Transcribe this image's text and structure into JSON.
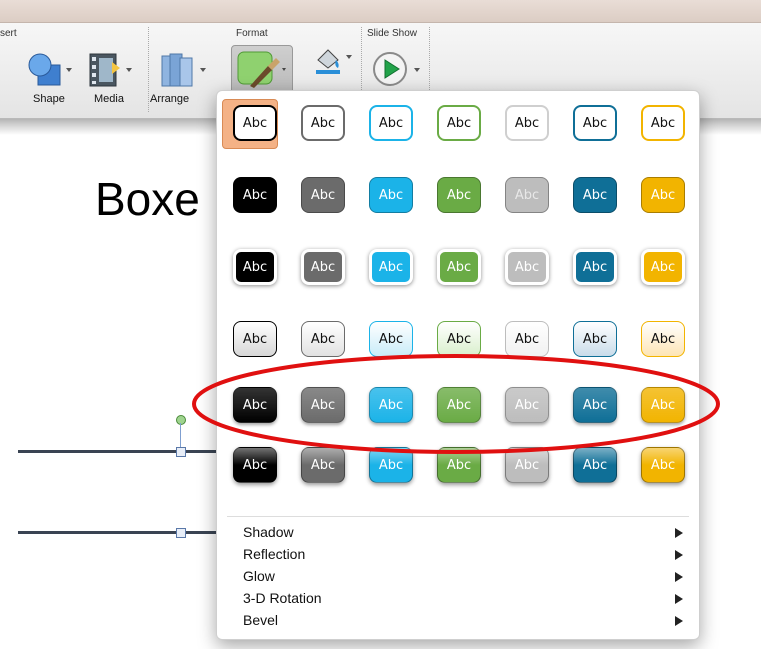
{
  "ribbon": {
    "groups": {
      "insert_partial": "sert",
      "format": "Format",
      "slide_show": "Slide Show"
    },
    "tools": {
      "shape": "Shape",
      "media": "Media",
      "arrange": "Arrange"
    }
  },
  "slide": {
    "title_partial": "Boxe"
  },
  "gallery": {
    "rows": [
      {
        "style": "outline",
        "cells": [
          "Abc",
          "Abc",
          "Abc",
          "Abc",
          "Abc",
          "Abc",
          "Abc"
        ]
      },
      {
        "style": "fill",
        "cells": [
          "Abc",
          "Abc",
          "Abc",
          "Abc",
          "Abc",
          "Abc",
          "Abc"
        ]
      },
      {
        "style": "fill-white-border",
        "cells": [
          "Abc",
          "Abc",
          "Abc",
          "Abc",
          "Abc",
          "Abc",
          "Abc"
        ]
      },
      {
        "style": "light-gradient",
        "cells": [
          "Abc",
          "Abc",
          "Abc",
          "Abc",
          "Abc",
          "Abc",
          "Abc"
        ]
      },
      {
        "style": "gradient",
        "cells": [
          "Abc",
          "Abc",
          "Abc",
          "Abc",
          "Abc",
          "Abc",
          "Abc"
        ]
      },
      {
        "style": "glossy",
        "cells": [
          "Abc",
          "Abc",
          "Abc",
          "Abc",
          "Abc",
          "Abc",
          "Abc"
        ]
      }
    ],
    "colors": [
      "#000000",
      "#6b6b6b",
      "#1bb3e8",
      "#6aab45",
      "#bdbdbd",
      "#0f6f97",
      "#f2b400"
    ],
    "light_colors": [
      "#d7d7d7",
      "#e2e2e2",
      "#c9ecf8",
      "#d9efcc",
      "#f1f1f1",
      "#c9dcea",
      "#fde5b5"
    ],
    "menu": [
      {
        "label": "Shadow"
      },
      {
        "label": "Reflection"
      },
      {
        "label": "Glow"
      },
      {
        "label": "3-D Rotation"
      },
      {
        "label": "Bevel"
      }
    ]
  },
  "annotation": {
    "shape": "ellipse",
    "color": "#e01010"
  }
}
